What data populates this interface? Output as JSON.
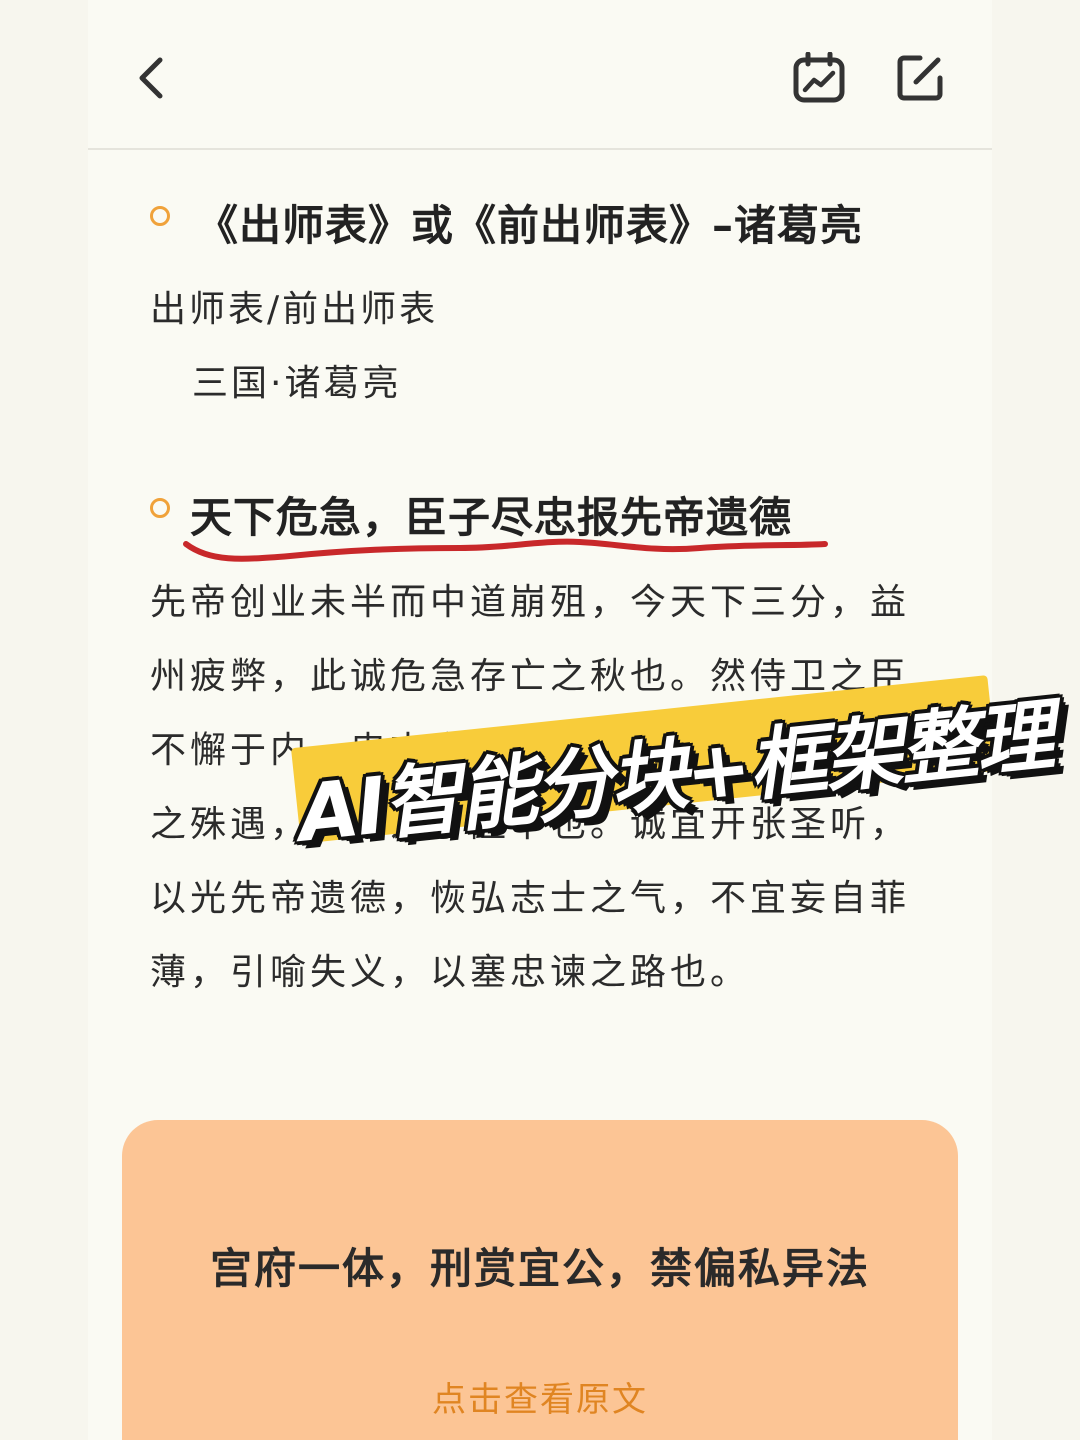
{
  "header": {
    "back_icon": "chevron-left-icon",
    "chart_icon": "trend-chart-icon",
    "edit_icon": "edit-icon"
  },
  "sections": [
    {
      "heading": "《出师表》或《前出师表》–诸葛亮",
      "lines": [
        "出师表/前出师表",
        "三国·诸葛亮"
      ]
    },
    {
      "heading": "天下危急，臣子尽忠报先帝遗德",
      "paragraph": "先帝创业未半而中道崩殂，今天下三分，益州疲弊，此诚危急存亡之秋也。然侍卫之臣不懈于内，忠志之士忘身于外者，盖追先帝之殊遇，欲报之于陛下也。诚宜开张圣听，以光先帝遗德，恢弘志士之气，不宜妄自菲薄，引喻失义，以塞忠谏之路也。"
    }
  ],
  "overlay_banner": "AI智能分块+框架整理",
  "card": {
    "title": "宫府一体，刑赏宜公，禁偏私异法",
    "link": "点击查看原文"
  },
  "colors": {
    "accent": "#f0a23a",
    "card_bg": "#fcc595",
    "link": "#e08522",
    "underline": "#c8282a",
    "banner_yellow": "#f8cc3a"
  }
}
